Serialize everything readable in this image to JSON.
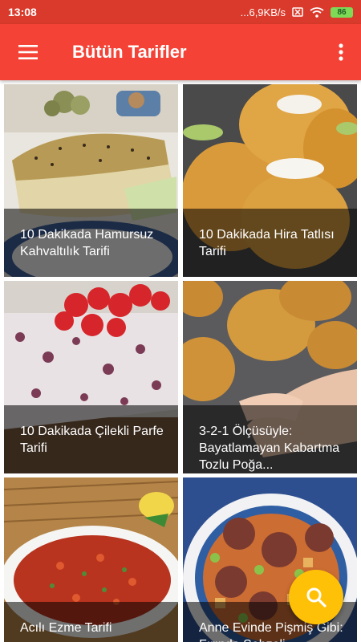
{
  "status_bar": {
    "time": "13:08",
    "network_speed": "...6,9KB/s",
    "battery_level": "86"
  },
  "app_bar": {
    "title": "Bütün Tarifler",
    "menu_icon": "hamburger-menu-icon",
    "overflow_icon": "more-vert-icon"
  },
  "recipes": [
    {
      "title": "10 Dakikada Hamursuz Kahvaltılık Tarifi"
    },
    {
      "title": "10 Dakikada Hira Tatlısı Tarifi"
    },
    {
      "title": "10 Dakikada Çilekli Parfe Tarifi"
    },
    {
      "title": "3-2-1 Ölçüsüyle: Bayatlamayan Kabartma Tozlu Poğa..."
    },
    {
      "title": "Acılı Ezme Tarifi"
    },
    {
      "title": "Anne Evinde Pişmiş Gibi: Fırında Sebzeli"
    }
  ],
  "fab": {
    "icon": "search-icon",
    "color": "#ffc107"
  },
  "colors": {
    "app_bar": "#f44336",
    "status_bar": "#d93a2b"
  }
}
